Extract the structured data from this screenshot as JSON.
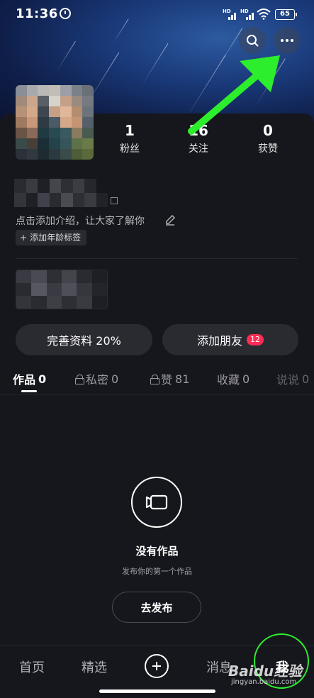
{
  "status_bar": {
    "time": "11:36",
    "signal_label": "HD",
    "battery": "65"
  },
  "top_actions": {
    "search_icon": "search-icon",
    "more_icon": "more-icon"
  },
  "profile": {
    "stats": [
      {
        "value": "1",
        "label": "粉丝"
      },
      {
        "value": "16",
        "label": "关注"
      },
      {
        "value": "0",
        "label": "获赞"
      }
    ],
    "bio_placeholder": "点击添加介绍，让大家了解你",
    "age_tag": "添加年龄标签"
  },
  "actions": {
    "complete_profile": "完善资料 20%",
    "add_friends": "添加朋友",
    "add_friends_badge": "12"
  },
  "tabs": [
    {
      "label": "作品",
      "count": "0",
      "locked": false
    },
    {
      "label": "私密",
      "count": "0",
      "locked": true
    },
    {
      "label": "赞",
      "count": "81",
      "locked": true
    },
    {
      "label": "收藏",
      "count": "0",
      "locked": false
    },
    {
      "label": "说说",
      "count": "0",
      "locked": false
    }
  ],
  "empty_state": {
    "title": "没有作品",
    "subtitle": "发布你的第一个作品",
    "button": "去发布"
  },
  "bottom_nav": {
    "home": "首页",
    "featured": "精选",
    "messages": "消息",
    "me": "我"
  },
  "watermark": {
    "logo": "Baidu经验",
    "url": "jingyan.baidu.com"
  },
  "colors": {
    "accent_badge": "#fe2c55",
    "annotation": "#2dee2d",
    "panel": "#16171c"
  }
}
